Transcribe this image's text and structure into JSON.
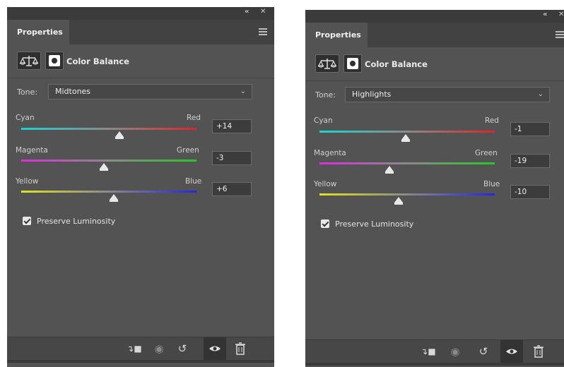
{
  "panels": [
    {
      "tab_label": "Properties",
      "window_controls": {
        "collapse": "«",
        "close": "✕"
      },
      "adjustment_title": "Color Balance",
      "tone_label": "Tone:",
      "tone_value": "Midtones",
      "sliders": [
        {
          "left": "Cyan",
          "right": "Red",
          "value": "+14",
          "level": 0.56
        },
        {
          "left": "Magenta",
          "right": "Green",
          "value": "-3",
          "level": 0.47
        },
        {
          "left": "Yellow",
          "right": "Blue",
          "value": "+6",
          "level": 0.53
        }
      ],
      "preserve_luminosity_label": "Preserve Luminosity",
      "preserve_luminosity_checked": true
    },
    {
      "tab_label": "Properties",
      "window_controls": {
        "collapse": "«",
        "close": "✕"
      },
      "adjustment_title": "Color Balance",
      "tone_label": "Tone:",
      "tone_value": "Highlights",
      "sliders": [
        {
          "left": "Cyan",
          "right": "Red",
          "value": "-1",
          "level": 0.49
        },
        {
          "left": "Magenta",
          "right": "Green",
          "value": "-19",
          "level": 0.4
        },
        {
          "left": "Yellow",
          "right": "Blue",
          "value": "-10",
          "level": 0.45
        }
      ],
      "preserve_luminosity_label": "Preserve Luminosity",
      "preserve_luminosity_checked": true
    }
  ],
  "footer_icons": [
    "clip-to-layer-icon",
    "view-previous-state-icon",
    "reset-icon",
    "visibility-eye-icon",
    "trash-icon"
  ]
}
